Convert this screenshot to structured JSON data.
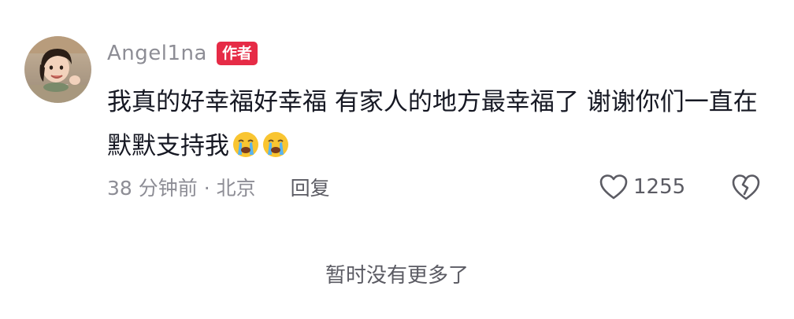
{
  "comment": {
    "username": "Angel1na",
    "author_badge": "作者",
    "text": "我真的好幸福好幸福 有家人的地方最幸福了 谢谢你们一直在默默支持我",
    "emojis": [
      "loudly-crying-face",
      "loudly-crying-face"
    ],
    "time_location": "38 分钟前 · 北京",
    "reply_label": "回复",
    "like_count": "1255",
    "like_icon": "heart-outline-icon",
    "dislike_icon": "broken-heart-icon"
  },
  "footer": {
    "no_more_text": "暂时没有更多了"
  },
  "colors": {
    "badge": "#e62b46",
    "text_primary": "#161823",
    "text_secondary": "#8d8d95"
  }
}
